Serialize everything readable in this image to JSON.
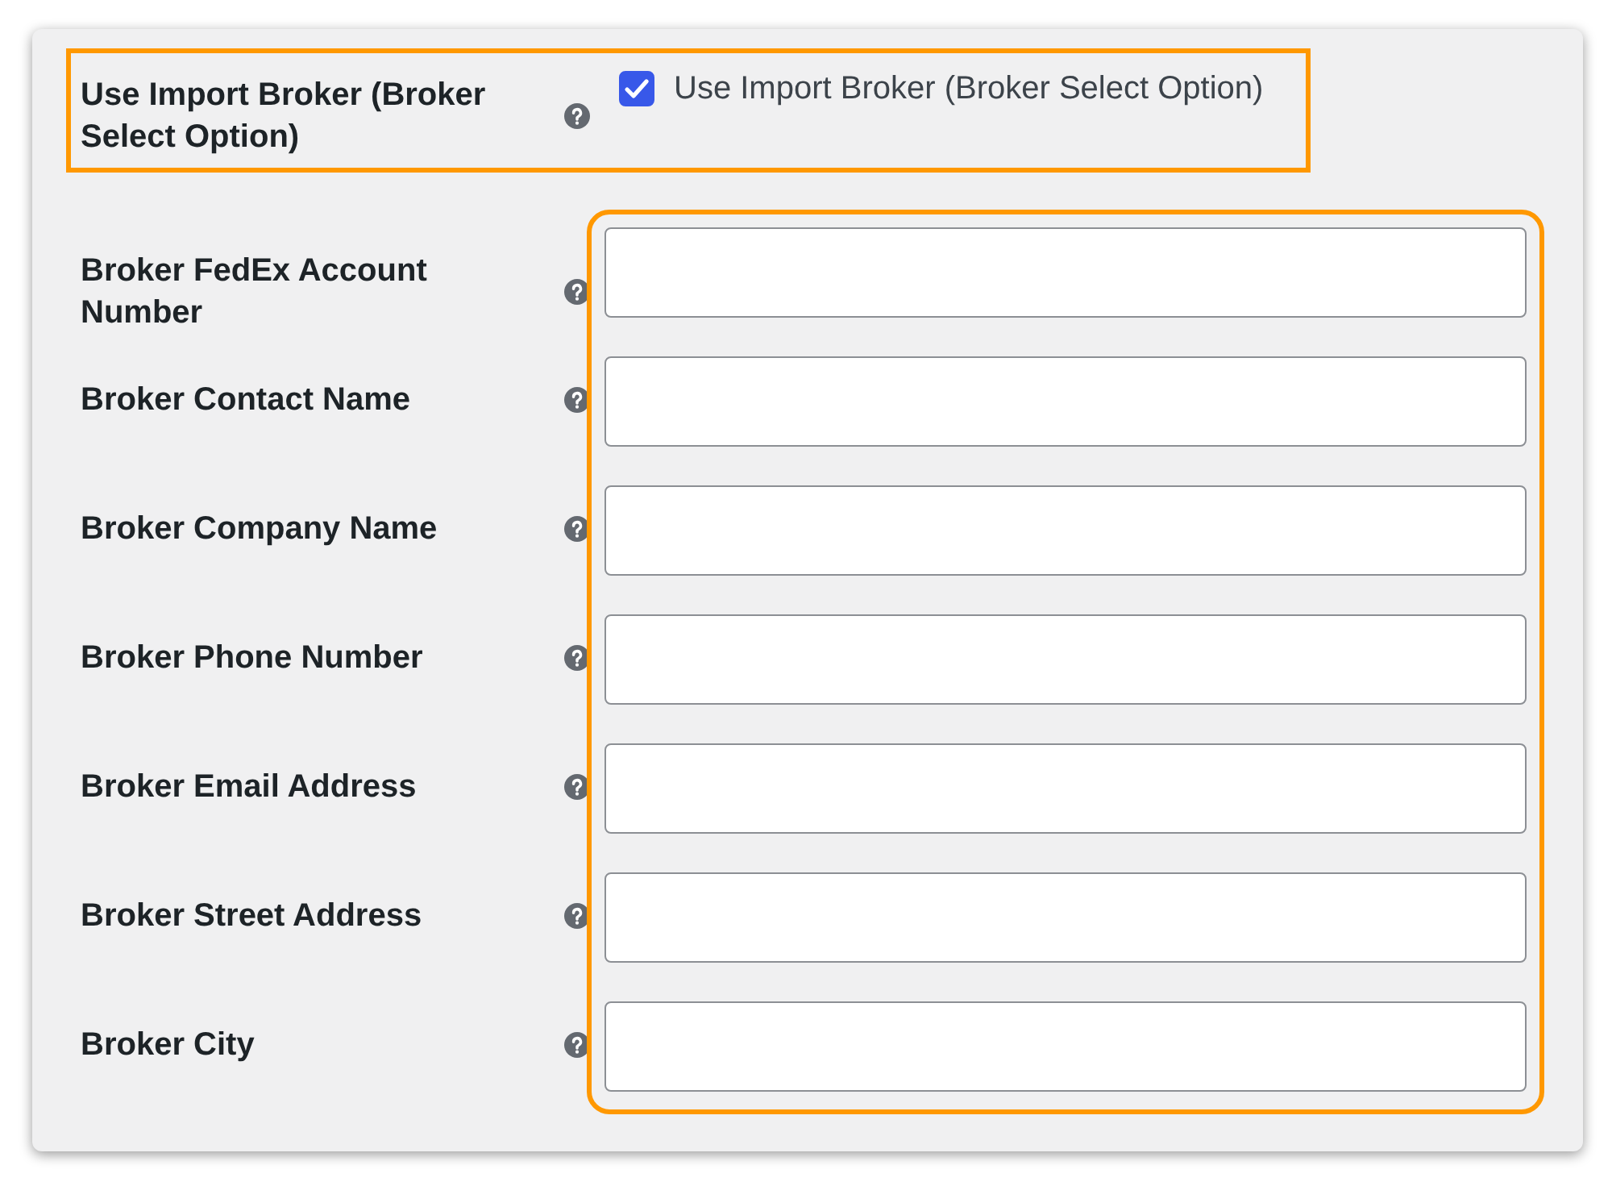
{
  "import_broker": {
    "label": "Use Import Broker (Broker Select Option)",
    "highlighted": true,
    "checkbox": {
      "label": "Use Import Broker (Broker Select Option)",
      "checked": true
    }
  },
  "broker_fields": {
    "highlighted": true,
    "fields": [
      {
        "label": "Broker FedEx Account Number"
      },
      {
        "label": "Broker Contact Name"
      },
      {
        "label": "Broker Company Name"
      },
      {
        "label": "Broker Phone Number"
      },
      {
        "label": "Broker Email Address"
      },
      {
        "label": "Broker Street Address"
      },
      {
        "label": "Broker City"
      }
    ]
  }
}
